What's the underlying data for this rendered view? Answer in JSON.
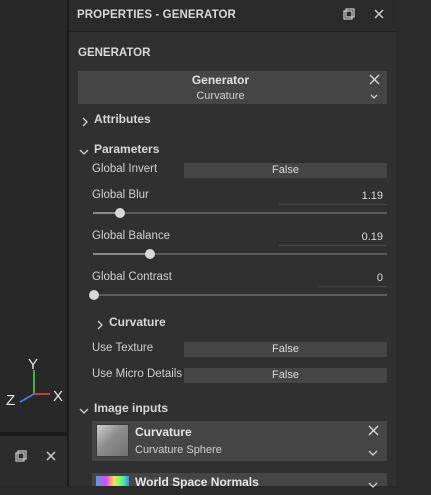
{
  "window": {
    "title": "PROPERTIES - GENERATOR",
    "icons": [
      "restore-icon",
      "close-icon"
    ]
  },
  "viewport": {
    "gizmo": {
      "y": "Y",
      "x": "X",
      "z": "Z"
    },
    "axis_colors": {
      "x": "#e04545",
      "y": "#4bd24b",
      "z": "#4a7de0"
    },
    "icons": [
      "restore-icon",
      "close-icon"
    ]
  },
  "generator_section": {
    "heading": "GENERATOR",
    "box_title": "Generator",
    "selected": "Curvature"
  },
  "attributes": {
    "label": "Attributes",
    "expanded": false
  },
  "parameters": {
    "label": "Parameters",
    "expanded": true,
    "global_invert": {
      "label": "Global Invert",
      "value": "False"
    },
    "global_blur": {
      "label": "Global Blur",
      "value": "1.19",
      "slider_fraction": 0.09
    },
    "global_balance": {
      "label": "Global Balance",
      "value": "0.19",
      "slider_fraction": 0.19
    },
    "global_contrast": {
      "label": "Global Contrast",
      "value": "0",
      "slider_fraction": 0.0
    }
  },
  "curvature": {
    "label": "Curvature",
    "expanded": false,
    "use_texture": {
      "label": "Use Texture",
      "value": "False"
    },
    "use_micro_details": {
      "label": "Use Micro Details",
      "value": "False"
    }
  },
  "image_inputs": {
    "label": "Image inputs",
    "expanded": true,
    "items": [
      {
        "title": "Curvature",
        "selected": "Curvature Sphere"
      },
      {
        "title": "World Space Normals"
      }
    ]
  }
}
